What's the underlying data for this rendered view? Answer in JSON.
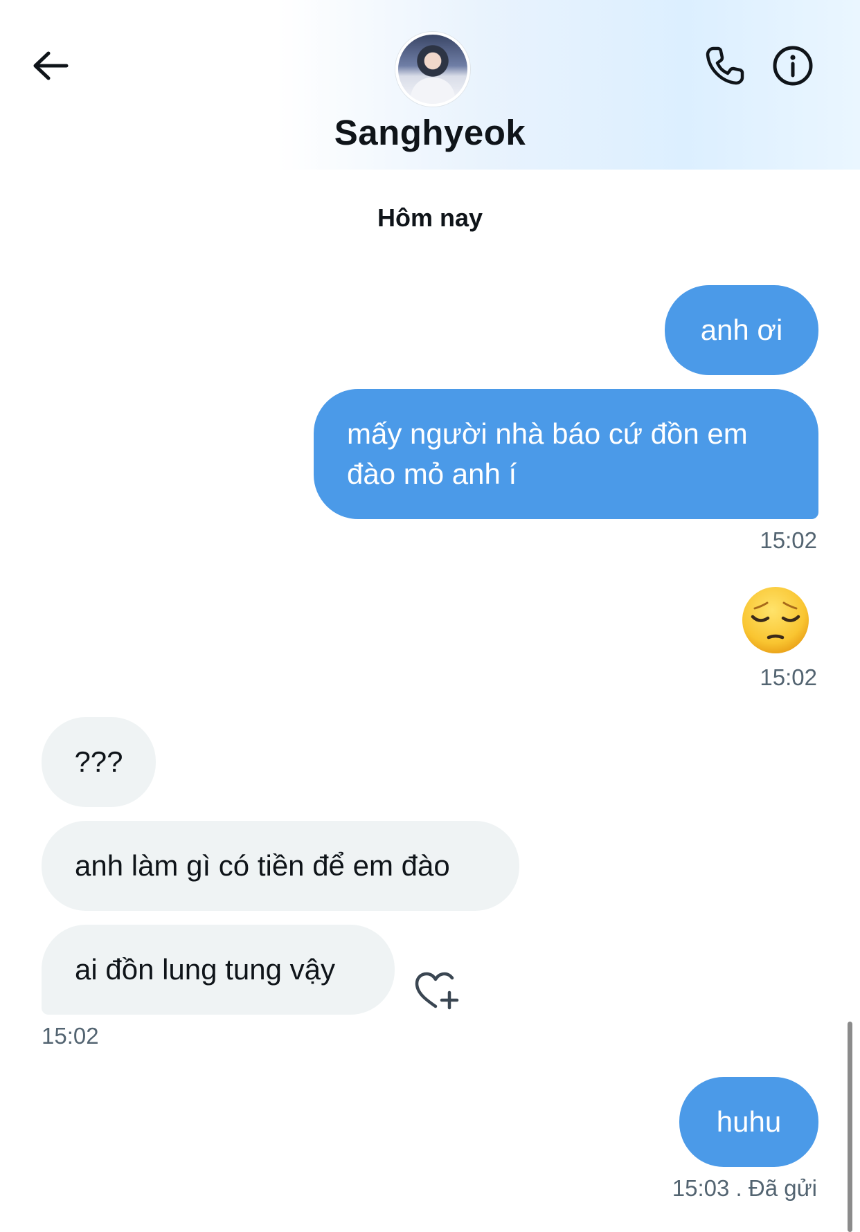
{
  "header": {
    "contact_name": "Sanghyeok",
    "back_icon": "arrow-left-icon",
    "call_icon": "phone-icon",
    "info_icon": "info-icon"
  },
  "conversation": {
    "date_separator": "Hôm nay",
    "messages": [
      {
        "direction": "outgoing",
        "text": "anh ơi"
      },
      {
        "direction": "outgoing",
        "text": "mấy người nhà báo cứ đồn em đào mỏ anh í",
        "time": "15:02"
      },
      {
        "direction": "outgoing",
        "emoji": "pensive-face",
        "time": "15:02"
      },
      {
        "direction": "incoming",
        "text": "???"
      },
      {
        "direction": "incoming",
        "text": "anh làm gì có tiền để em đào"
      },
      {
        "direction": "incoming",
        "text": "ai đồn lung tung vậy",
        "time": "15:02",
        "reaction_icon": "heart-plus-icon"
      },
      {
        "direction": "outgoing",
        "text": "huhu",
        "time": "15:03",
        "status": ". Đã gửi"
      }
    ],
    "last_status_line": "15:03  . Đã gửi"
  },
  "colors": {
    "outgoing_bubble": "#4b9ae8",
    "incoming_bubble": "#eff3f4",
    "timestamp": "#536471"
  }
}
